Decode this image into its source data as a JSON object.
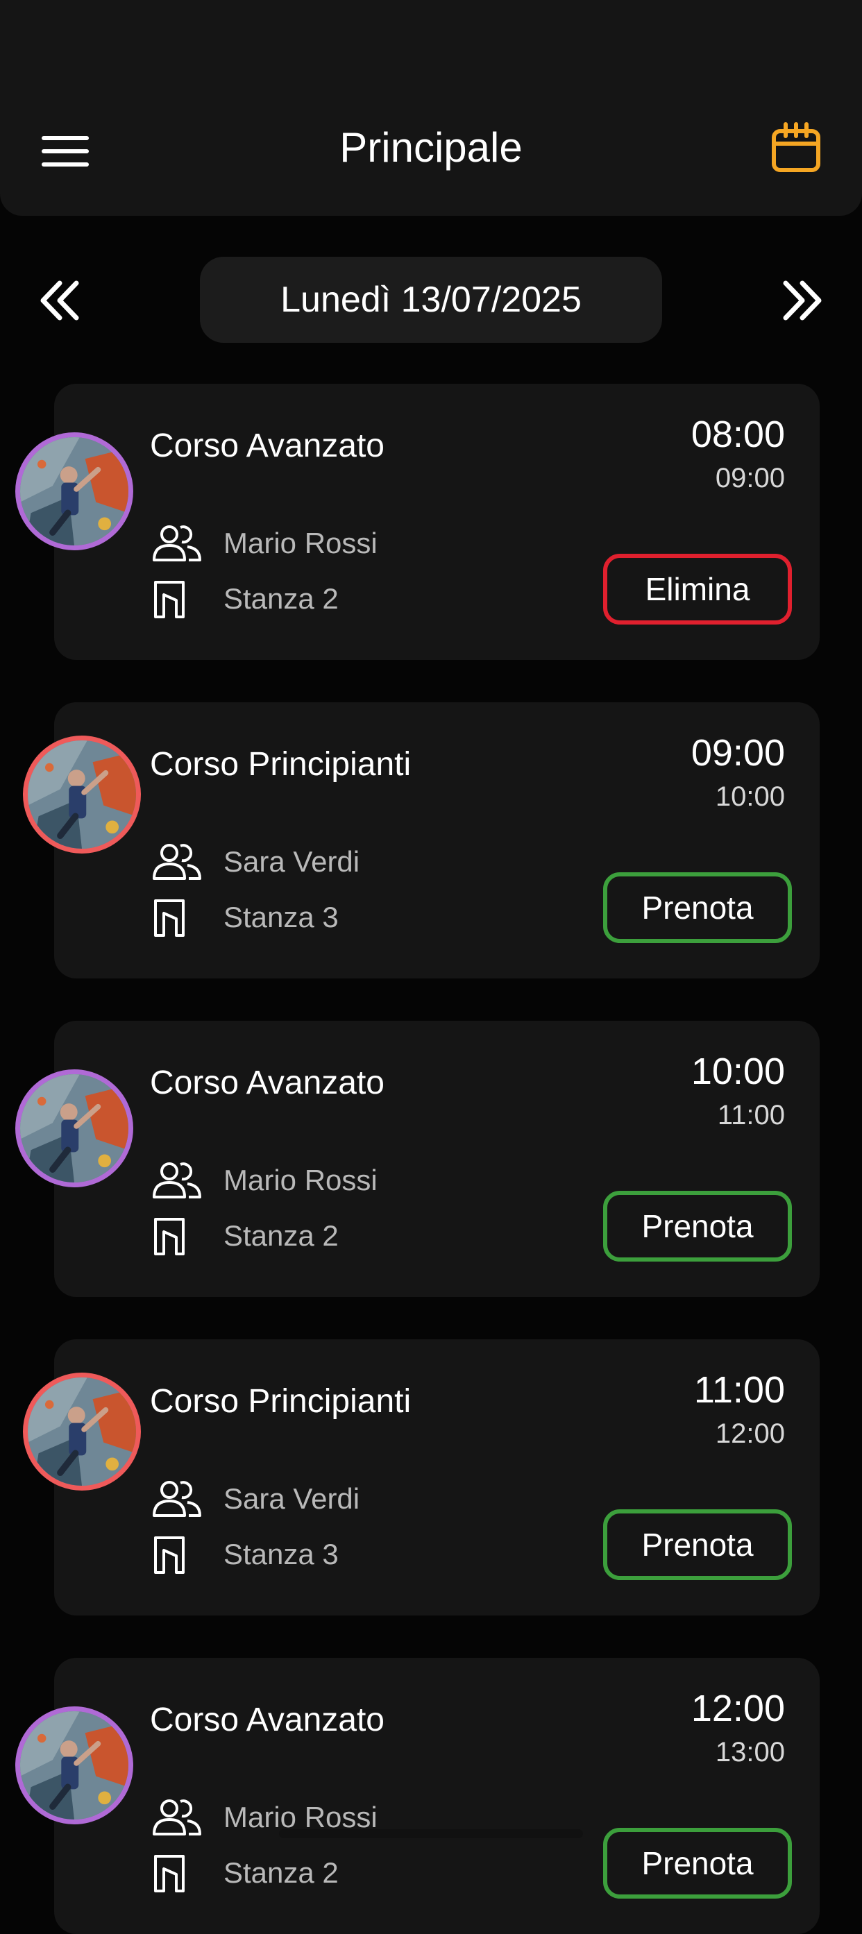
{
  "header": {
    "title": "Principale",
    "menu_icon": "hamburger-icon",
    "calendar_icon": "calendar-icon",
    "accent_color": "#f5a623"
  },
  "date_nav": {
    "label": "Lunedì 13/07/2025",
    "prev_icon": "double-chevron-left-icon",
    "next_icon": "double-chevron-right-icon"
  },
  "colors": {
    "advanced_ring": "#b06ad6",
    "beginner_ring": "#ef5a5a",
    "book_border": "#3c9f3c",
    "delete_border": "#e0202e"
  },
  "lessons": [
    {
      "title": "Corso Avanzato",
      "start": "08:00",
      "end": "09:00",
      "instructor": "Mario Rossi",
      "room": "Stanza 2",
      "action": "Elimina"
    },
    {
      "title": "Corso Principianti",
      "start": "09:00",
      "end": "10:00",
      "instructor": "Sara Verdi",
      "room": "Stanza 3",
      "action": "Prenota"
    },
    {
      "title": "Corso Avanzato",
      "start": "10:00",
      "end": "11:00",
      "instructor": "Mario Rossi",
      "room": "Stanza 2",
      "action": "Prenota"
    },
    {
      "title": "Corso Principianti",
      "start": "11:00",
      "end": "12:00",
      "instructor": "Sara Verdi",
      "room": "Stanza 3",
      "action": "Prenota"
    },
    {
      "title": "Corso Avanzato",
      "start": "12:00",
      "end": "13:00",
      "instructor": "Mario Rossi",
      "room": "Stanza 2",
      "action": "Prenota"
    }
  ]
}
